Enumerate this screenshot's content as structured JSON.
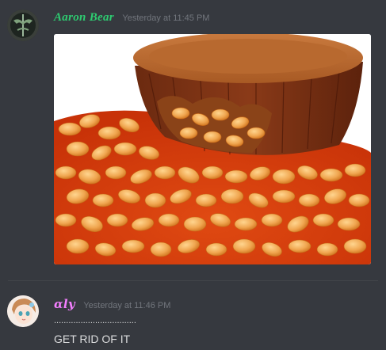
{
  "messages": [
    {
      "username": "Aaron Bear",
      "timestamp": "Yesterday at 11:45 PM",
      "attachment": {
        "type": "image",
        "subject": "peanut-butter-cup-in-baked-beans"
      }
    },
    {
      "username": "αly",
      "timestamp": "Yesterday at 11:46 PM",
      "lines": [
        "..................................",
        "GET RID OF IT"
      ]
    }
  ],
  "colors": {
    "background": "#36393f",
    "text": "#dcddde",
    "timestamp": "#72767d",
    "user1": "#2ecc71",
    "user2": "#f47fff"
  }
}
